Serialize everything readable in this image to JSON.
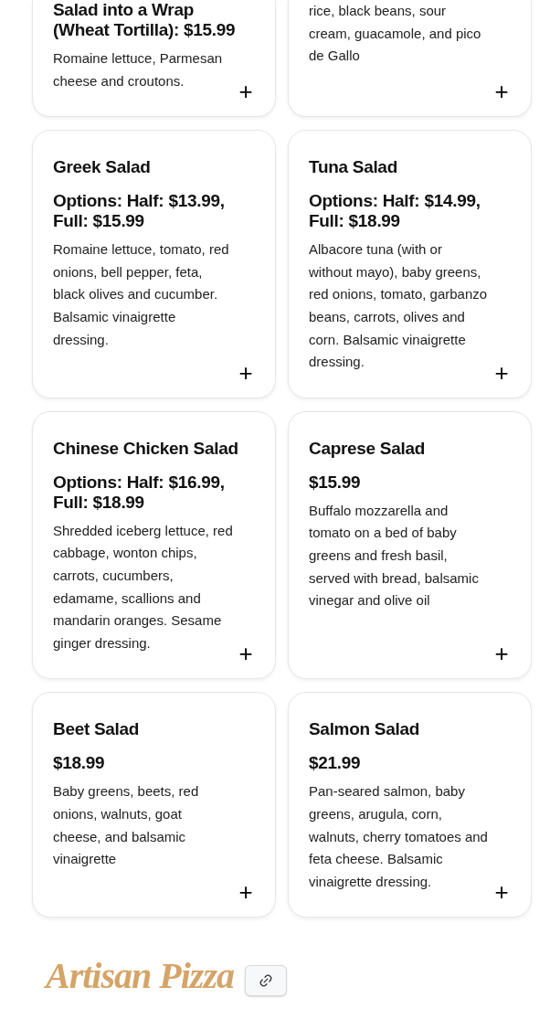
{
  "items": [
    {
      "price": "Salad into a Wrap (Wheat Tortilla): $15.99",
      "description": "Romaine lettuce, Parmesan cheese and croutons.",
      "add": "+"
    },
    {
      "description": "rice, black beans, sour cream, guacamole, and pico de Gallo",
      "add": "+"
    },
    {
      "title": "Greek Salad",
      "price": "Options: Half: $13.99, Full: $15.99",
      "description": "Romaine lettuce, tomato, red onions, bell pepper, feta, black olives and cucumber. Balsamic vinaigrette dressing.",
      "add": "+"
    },
    {
      "title": "Tuna Salad",
      "price": "Options: Half: $14.99, Full: $18.99",
      "description": "Albacore tuna (with or without mayo), baby greens, red onions, tomato, garbanzo beans, carrots, olives and corn. Balsamic vinaigrette dressing.",
      "add": "+"
    },
    {
      "title": "Chinese Chicken Salad",
      "price": "Options: Half: $16.99, Full: $18.99",
      "description": "Shredded iceberg lettuce, red cabbage, wonton chips, carrots, cucumbers, edamame, scallions and mandarin oranges. Sesame ginger dressing.",
      "add": "+"
    },
    {
      "title": "Caprese Salad",
      "price": "$15.99",
      "description": "Buffalo mozzarella and tomato on a bed of baby greens and fresh basil, served with bread, balsamic vinegar and olive oil",
      "add": "+"
    },
    {
      "title": "Beet Salad",
      "price": "$18.99",
      "description": "Baby greens, beets, red onions, walnuts, goat cheese, and balsamic vinaigrette",
      "add": "+"
    },
    {
      "title": "Salmon Salad",
      "price": "$21.99",
      "description": "Pan-seared salmon, baby greens, arugula, corn, walnuts, cherry tomatoes and feta cheese. Balsamic vinaigrette dressing.",
      "add": "+"
    }
  ],
  "section": {
    "title": "Artisan Pizza"
  }
}
